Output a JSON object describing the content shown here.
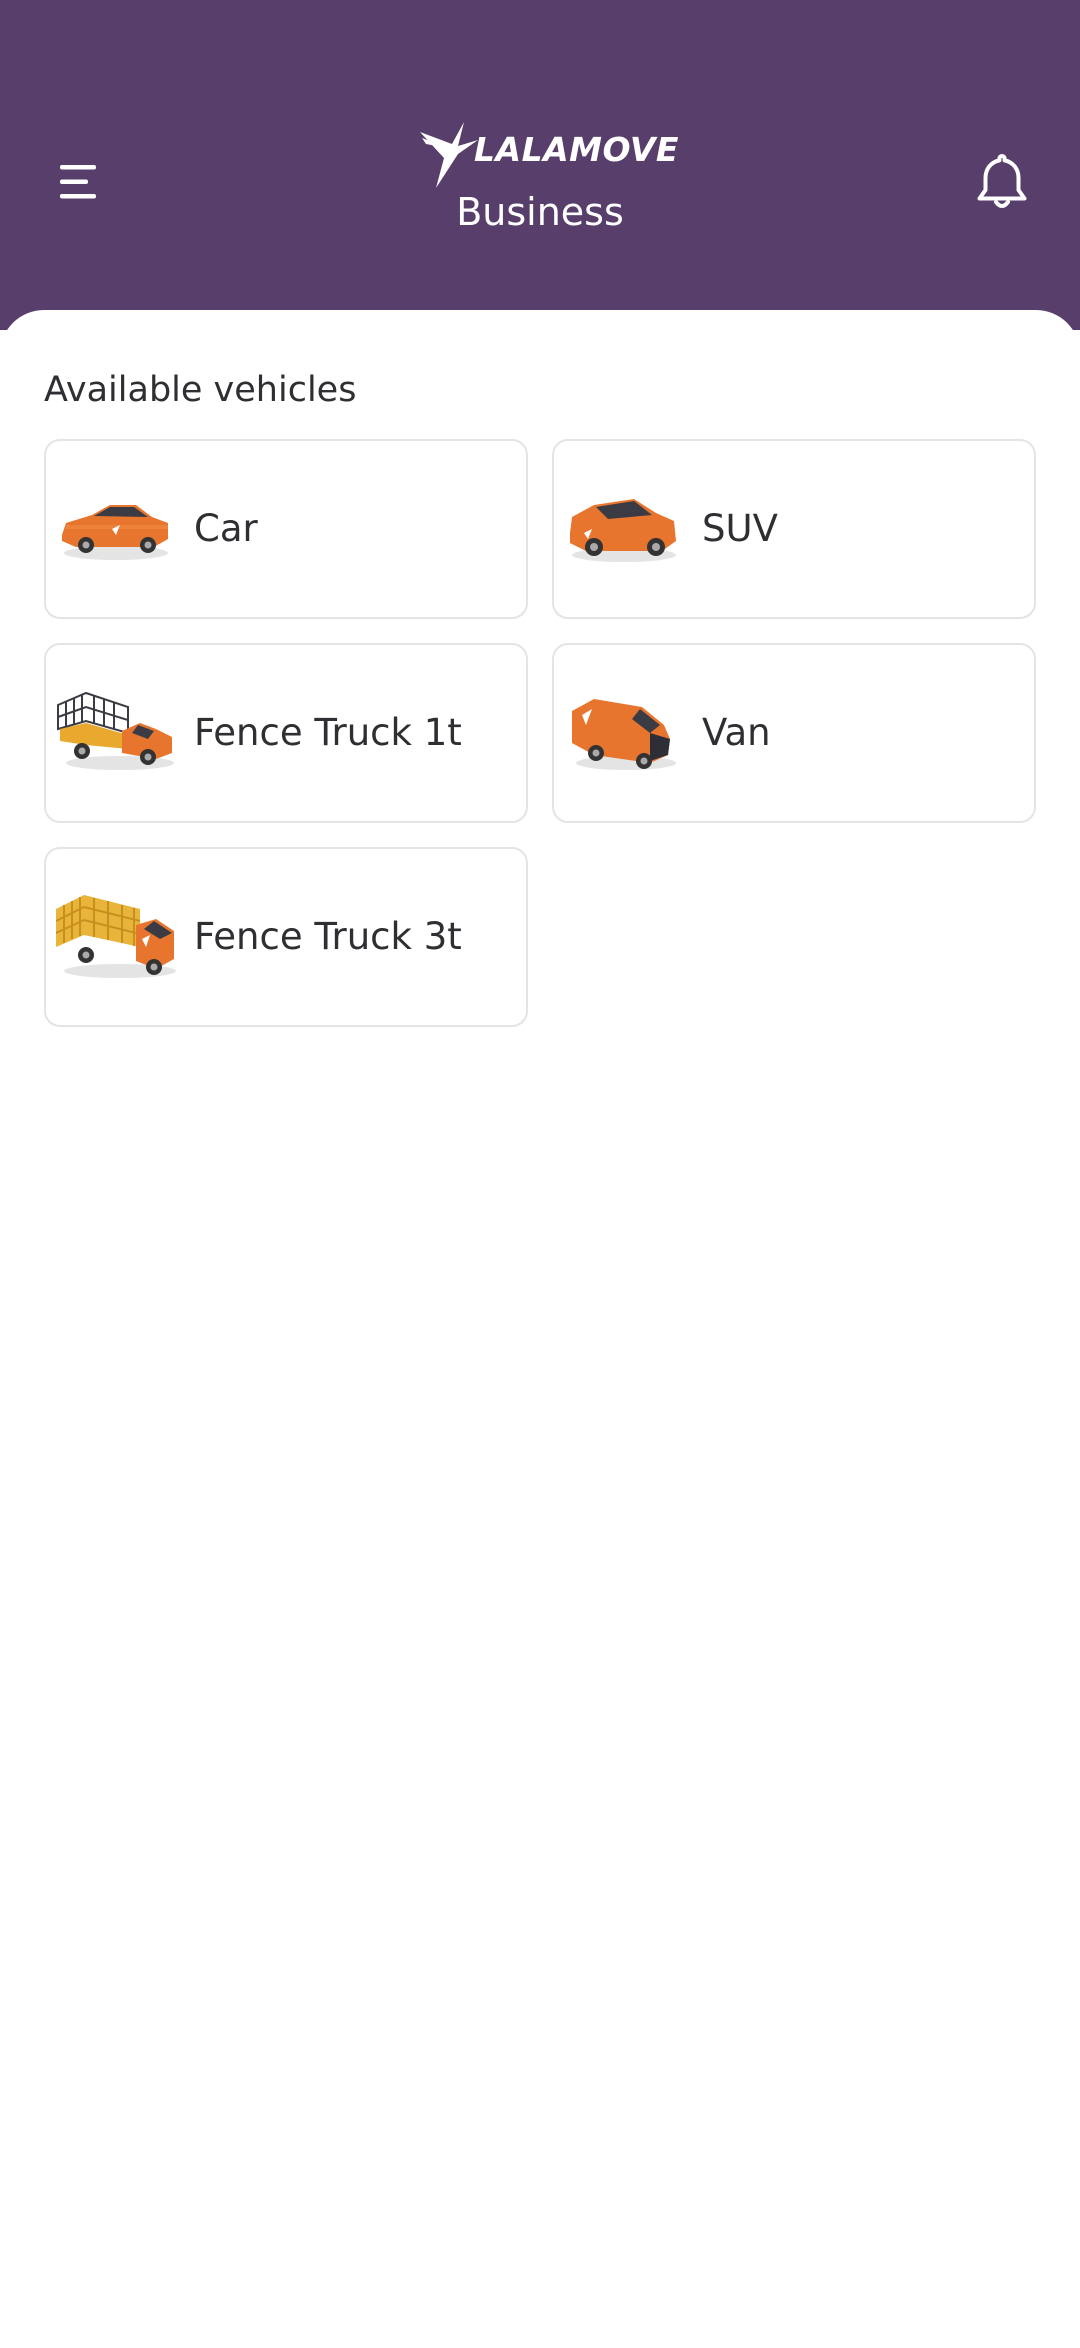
{
  "header": {
    "brand": "LALAMOVE",
    "subtitle": "Business",
    "menu_icon": "menu-icon",
    "notification_icon": "bell-icon",
    "background_color": "#583e6a"
  },
  "main": {
    "section_title": "Available vehicles",
    "vehicles": [
      {
        "label": "Car",
        "icon": "car-icon"
      },
      {
        "label": "SUV",
        "icon": "suv-icon"
      },
      {
        "label": "Fence Truck 1t",
        "icon": "fence-truck-1t-icon"
      },
      {
        "label": "Van",
        "icon": "van-icon"
      },
      {
        "label": "Fence Truck 3t",
        "icon": "fence-truck-3t-icon"
      }
    ],
    "vehicle_color": "#e8752e"
  }
}
